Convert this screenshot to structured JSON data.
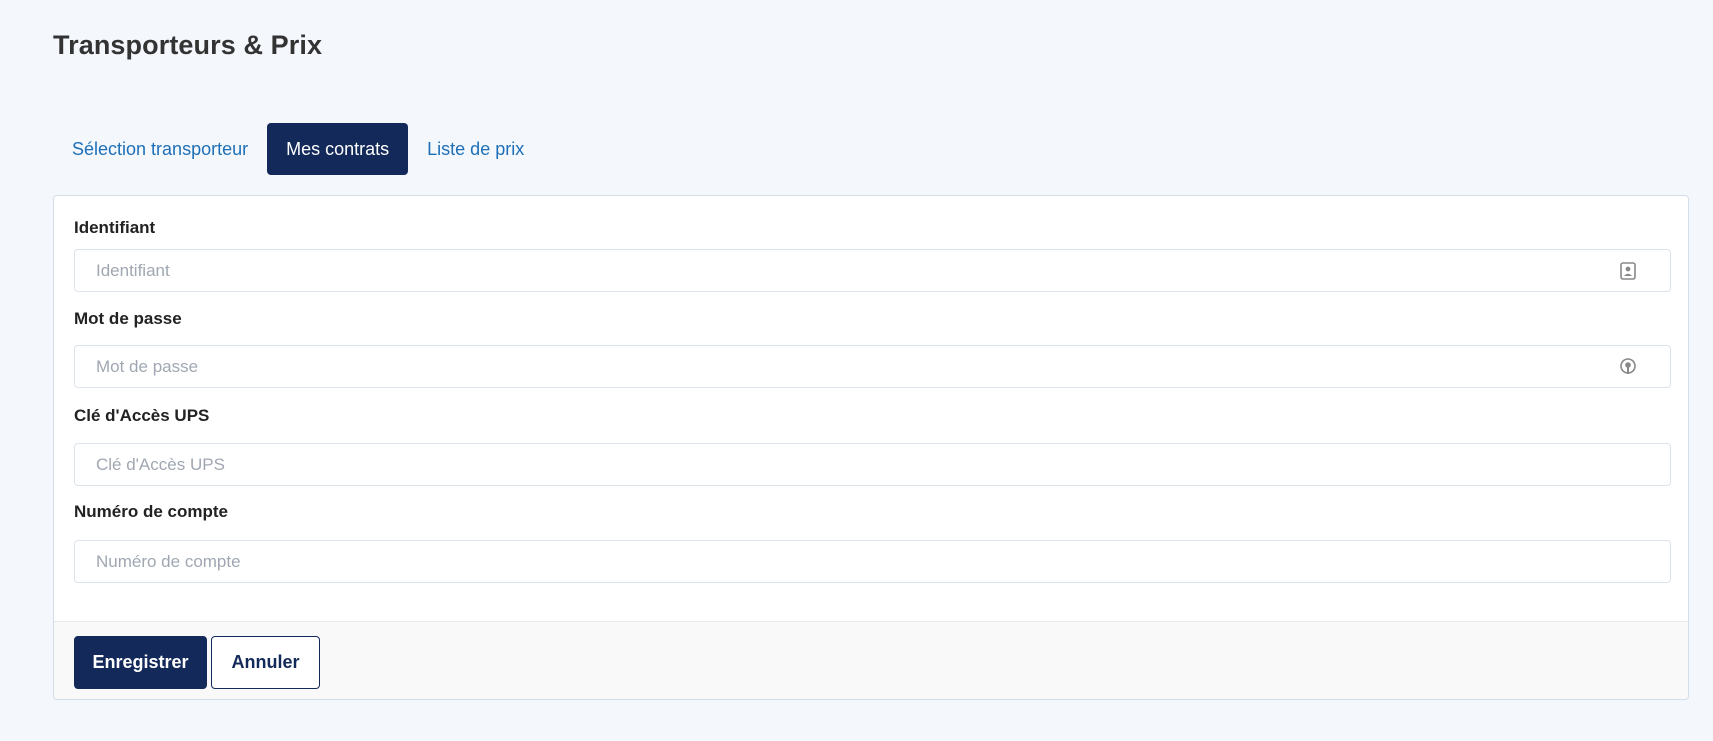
{
  "page": {
    "title": "Transporteurs & Prix"
  },
  "tabs": [
    {
      "label": "Sélection transporteur",
      "active": false
    },
    {
      "label": "Mes contrats",
      "active": true
    },
    {
      "label": "Liste de prix",
      "active": false
    }
  ],
  "form": {
    "fields": [
      {
        "label": "Identifiant",
        "placeholder": "Identifiant",
        "value": "",
        "icon": "contact-card-icon"
      },
      {
        "label": "Mot de passe",
        "placeholder": "Mot de passe",
        "value": "",
        "icon": "password-key-icon"
      },
      {
        "label": "Clé d'Accès UPS",
        "placeholder": "Clé d'Accès UPS",
        "value": ""
      },
      {
        "label": "Numéro de compte",
        "placeholder": "Numéro de compte",
        "value": ""
      }
    ]
  },
  "footer": {
    "save_label": "Enregistrer",
    "cancel_label": "Annuler"
  },
  "colors": {
    "background": "#f4f7fc",
    "primary": "#13295a",
    "tab_link": "#1d6fb8",
    "placeholder": "#a0a7b2",
    "icon": "#888888"
  }
}
